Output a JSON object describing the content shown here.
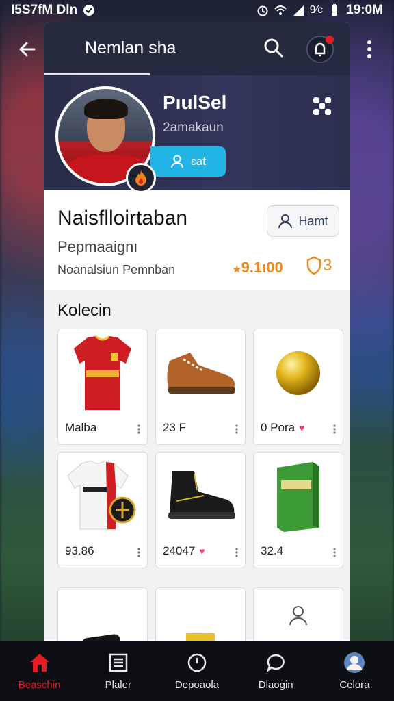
{
  "status_bar": {
    "left_text": "I5S7fM Dln",
    "time": "19:0M",
    "battery_text": "9⁄c"
  },
  "header": {
    "title": "Nemlan sha"
  },
  "profile": {
    "name": "PıulSel",
    "subtitle": "2amakaun",
    "follow_label": "ɛat"
  },
  "info": {
    "title": "Naisflloirtaban",
    "subtitle": "Pepmaaignı",
    "subtitle2": "Noanalsiun Pemnban",
    "edit_label": "Hamt",
    "points": "9.1ι00",
    "shield_count": "3"
  },
  "collection": {
    "title": "Kolecin",
    "items": [
      {
        "label": "Malba",
        "icon": "red-jersey-icon",
        "liked": false
      },
      {
        "label": "23 F",
        "icon": "brown-boot-icon",
        "liked": false
      },
      {
        "label": "0 Pora",
        "icon": "gold-ball-icon",
        "liked": true
      },
      {
        "label": "93.86",
        "icon": "white-jersey-icon",
        "liked": false
      },
      {
        "label": "24047",
        "icon": "black-boot-icon",
        "liked": true
      },
      {
        "label": "32.4",
        "icon": "green-box-icon",
        "liked": false
      }
    ]
  },
  "bottom_nav": [
    {
      "label": "Beaschin",
      "icon": "home-icon",
      "active": true
    },
    {
      "label": "Plaler",
      "icon": "list-icon",
      "active": false
    },
    {
      "label": "Depoaola",
      "icon": "clock-icon",
      "active": false
    },
    {
      "label": "Dlaogin",
      "icon": "chat-icon",
      "active": false
    },
    {
      "label": "Celora",
      "icon": "profile-icon",
      "active": false
    }
  ],
  "colors": {
    "accent": "#23b4e6",
    "brand_red": "#e31b23",
    "points_orange": "#f08a1c",
    "header_dark": "#262a3e"
  }
}
